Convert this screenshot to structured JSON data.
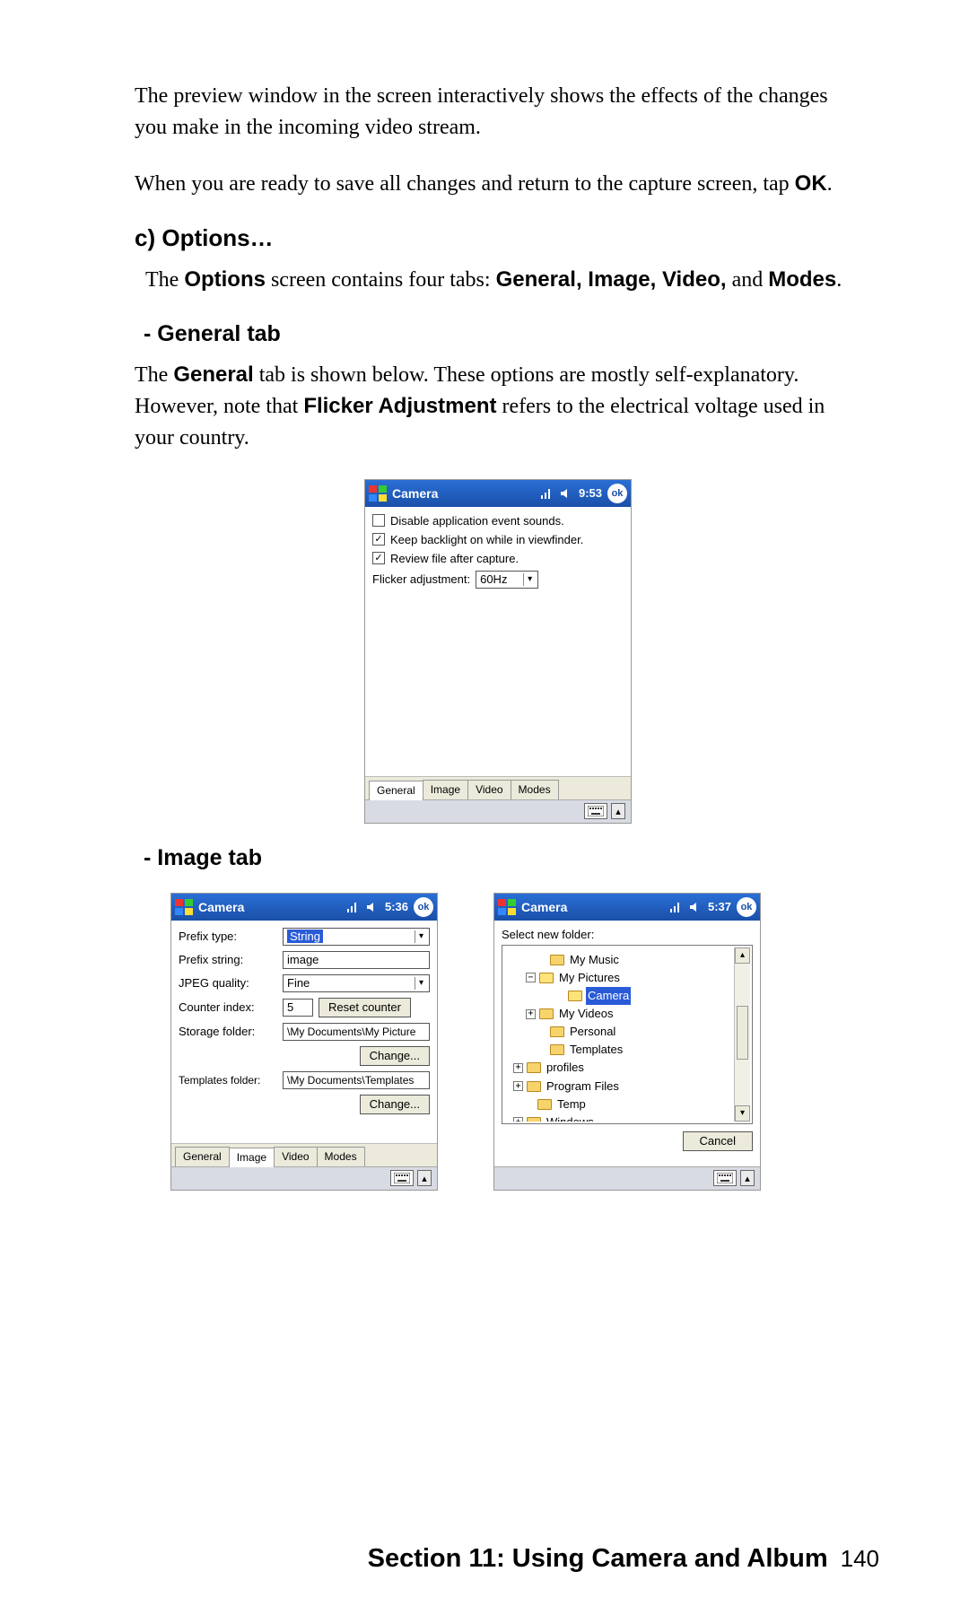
{
  "body": {
    "para1": "The preview window in the screen interactively shows the effects of the changes you make in the incoming video stream.",
    "para2_a": "When you are ready to save all changes and return to the capture screen, tap ",
    "para2_b": "OK",
    "para2_c": ".",
    "h_options": "c) Options…",
    "options_para_a": "The ",
    "options_para_b": "Options",
    "options_para_c": " screen contains four tabs: ",
    "options_para_d": "General, Image, Video,",
    "options_para_e": " and ",
    "options_para_f": "Modes",
    "options_para_g": ".",
    "h_general": "- General tab",
    "general_para_a": "The ",
    "general_para_b": "General",
    "general_para_c": " tab is shown below. These options are mostly self-explanatory. However, note that ",
    "general_para_d": "Flicker Adjustment",
    "general_para_e": " refers to the electrical voltage used in your country.",
    "h_image": "- Image tab"
  },
  "device_general": {
    "title": "Camera",
    "time": "9:53",
    "ok": "ok",
    "chk1": "Disable application event sounds.",
    "chk2": "Keep backlight on while in viewfinder.",
    "chk3": "Review file after capture.",
    "flicker_label": "Flicker adjustment:",
    "flicker_value": "60Hz",
    "tabs": [
      "General",
      "Image",
      "Video",
      "Modes"
    ]
  },
  "device_image": {
    "title": "Camera",
    "time": "5:36",
    "ok": "ok",
    "rows": {
      "prefix_type_label": "Prefix type:",
      "prefix_type_value": "String",
      "prefix_string_label": "Prefix string:",
      "prefix_string_value": "image",
      "jpeg_label": "JPEG quality:",
      "jpeg_value": "Fine",
      "counter_label": "Counter index:",
      "counter_value": "5",
      "reset_btn": "Reset counter",
      "storage_label": "Storage folder:",
      "storage_value": "\\My Documents\\My Picture",
      "change1": "Change...",
      "templates_label": "Templates folder:",
      "templates_value": "\\My Documents\\Templates",
      "change2": "Change..."
    },
    "tabs": [
      "General",
      "Image",
      "Video",
      "Modes"
    ]
  },
  "device_folder": {
    "title": "Camera",
    "time": "5:37",
    "ok": "ok",
    "select_label": "Select new folder:",
    "nodes": {
      "my_music": "My Music",
      "my_pictures": "My Pictures",
      "camera": "Camera",
      "my_videos": "My Videos",
      "personal": "Personal",
      "templates": "Templates",
      "profiles": "profiles",
      "program_files": "Program Files",
      "temp": "Temp",
      "windows": "Windows"
    },
    "cancel": "Cancel"
  },
  "footer": {
    "title": "Section 11: Using Camera and Album",
    "page": "140"
  }
}
